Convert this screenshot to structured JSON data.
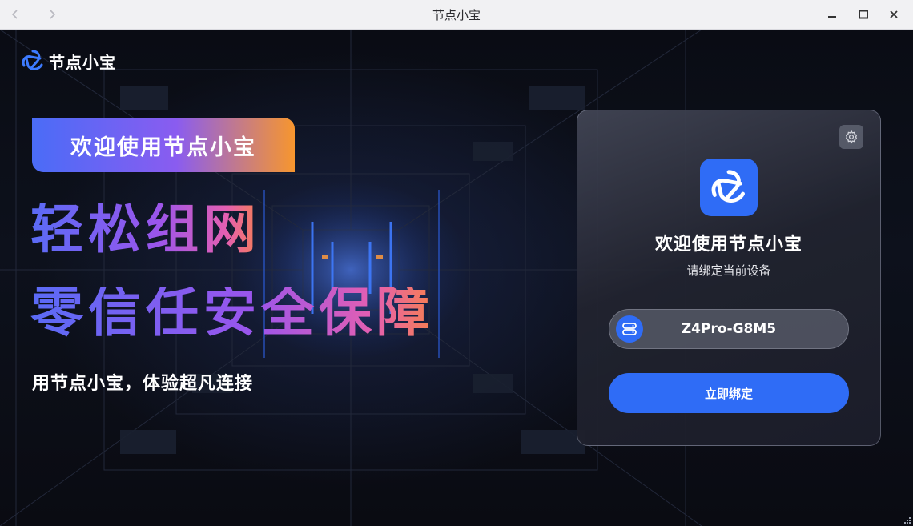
{
  "window": {
    "title": "节点小宝",
    "back_icon": "chevron-left-icon",
    "forward_icon": "chevron-right-icon",
    "controls": [
      "minimize-icon",
      "maximize-icon",
      "close-icon"
    ]
  },
  "brand": {
    "logo_text": "节点小宝",
    "logo_icon": "knot-logo-icon",
    "accent": "#2f6cf6"
  },
  "hero": {
    "welcome_tag": "欢迎使用节点小宝",
    "headline_1": "轻松组网",
    "headline_2": "零信任安全保障",
    "tagline": "用节点小宝，体验超凡连接"
  },
  "card": {
    "settings_icon": "gear-icon",
    "title": "欢迎使用节点小宝",
    "subtitle": "请绑定当前设备",
    "device_icon": "server-icon",
    "device_name": "Z4Pro-G8M5",
    "bind_button": "立即绑定"
  }
}
